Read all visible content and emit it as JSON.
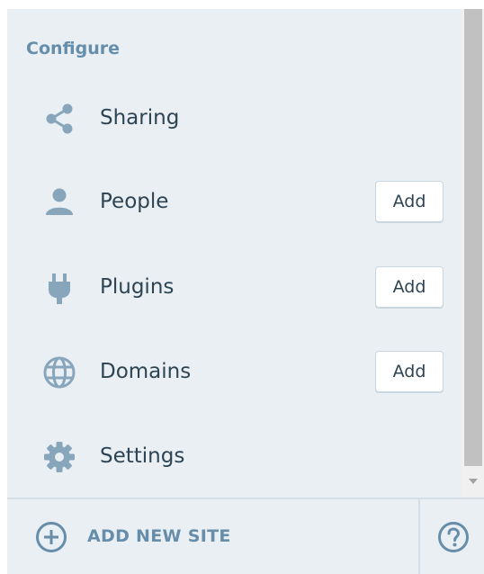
{
  "section": {
    "title": "Configure"
  },
  "menu": [
    {
      "label": "Sharing",
      "icon": "share-icon",
      "add": null
    },
    {
      "label": "People",
      "icon": "person-icon",
      "add": "Add"
    },
    {
      "label": "Plugins",
      "icon": "plug-icon",
      "add": "Add"
    },
    {
      "label": "Domains",
      "icon": "globe-icon",
      "add": "Add"
    },
    {
      "label": "Settings",
      "icon": "gear-icon",
      "add": null
    }
  ],
  "footer": {
    "add_site_label": "ADD NEW SITE",
    "add_site_icon": "plus-circle-icon",
    "help_icon": "help-icon"
  },
  "colors": {
    "panel_bg": "#e9eff3",
    "icon": "#87a6bc",
    "label": "#2e4453",
    "accent": "#668eaa",
    "border": "#c8d7e1"
  }
}
